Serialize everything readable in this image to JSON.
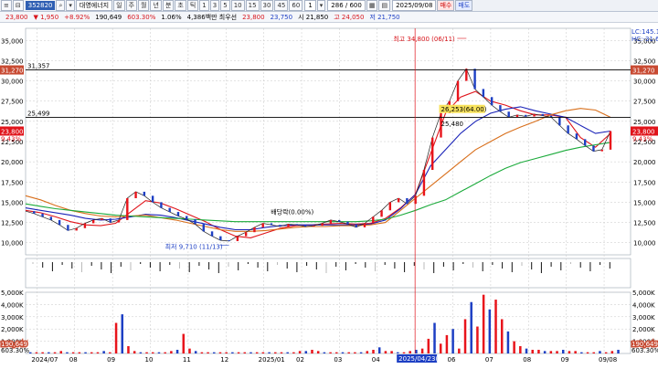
{
  "toolbar": {
    "code": "352820",
    "name": "대영에너지",
    "period_buttons": [
      "일",
      "주",
      "월",
      "년",
      "분",
      "초",
      "틱"
    ],
    "minute_buttons": [
      "1",
      "3",
      "5",
      "10",
      "15",
      "30",
      "45",
      "60"
    ],
    "tick_value": "1",
    "count_value": "286 / 600",
    "date_value": "2025/09/08"
  },
  "quote": {
    "price": "23,800",
    "change": "▼ 1,950",
    "change_pct": "+8.92%",
    "volume": "190,649",
    "volume_ratio": "603.30%",
    "turnover": "1.06%",
    "trade_value": "4,386백만 최우선",
    "ask": "23,800",
    "bid": "23,750",
    "open": "시 21,850",
    "high": "고 24,050",
    "low": "저 21,750",
    "buy_label": "매수",
    "sell_label": "매도"
  },
  "chart_data": {
    "type": "line",
    "x_labels": [
      "2024/07",
      "08",
      "09",
      "10",
      "11",
      "12",
      "2025/01",
      "02",
      "03",
      "04",
      "2025/04/23(수)",
      "06",
      "07",
      "08",
      "09",
      "09/08"
    ],
    "ylim": [
      8500,
      36500
    ],
    "y_ticks": [
      10000,
      12500,
      15000,
      17500,
      20000,
      22500,
      25000,
      27500,
      30000,
      32500,
      35000
    ],
    "y_tick_labels": [
      "10,000",
      "12,500",
      "15,000",
      "17,500",
      "20,000",
      "22,500",
      "25,000",
      "27,500",
      "30,000",
      "32,500",
      "35,000"
    ],
    "price_path": [
      13.9,
      13.6,
      13.2,
      12.8,
      12.2,
      11.5,
      11.8,
      12.4,
      12.8,
      13.0,
      12.5,
      12.8,
      15.5,
      16.3,
      15.8,
      15.0,
      14.3,
      13.8,
      13.3,
      12.9,
      12.3,
      11.4,
      10.8,
      10.3,
      10.2,
      10.8,
      11.3,
      11.9,
      12.4,
      12.2,
      12.0,
      12.3,
      12.2,
      12.0,
      12.1,
      12.4,
      12.8,
      12.6,
      12.3,
      11.9,
      12.4,
      13.2,
      14.0,
      15.0,
      15.5,
      14.8,
      15.8,
      19.0,
      23.0,
      26.0,
      27.5,
      30.0,
      31.5,
      29.0,
      28.0,
      27.0,
      26.2,
      25.5,
      25.8,
      25.6,
      25.9,
      25.7,
      25.5,
      24.5,
      23.5,
      22.8,
      22.0,
      21.3,
      21.5,
      23.8
    ],
    "ma20": [
      14.0,
      13.7,
      13.2,
      12.6,
      12.2,
      12.1,
      12.4,
      13.8,
      15.2,
      14.9,
      14.2,
      13.4,
      12.6,
      11.6,
      10.8,
      10.6,
      11.2,
      11.8,
      12.1,
      12.2,
      12.3,
      12.4,
      12.3,
      12.4,
      13.0,
      14.3,
      16.0,
      21.0,
      26.0,
      28.0,
      28.7,
      27.5,
      27.0,
      26.3,
      25.8,
      25.8,
      25.5,
      23.0,
      21.8,
      23.5
    ],
    "ma60": [
      14.3,
      14.0,
      13.7,
      13.4,
      13.0,
      12.8,
      12.9,
      13.2,
      13.5,
      13.4,
      13.1,
      12.7,
      12.3,
      11.9,
      11.6,
      11.6,
      11.9,
      12.1,
      12.2,
      12.2,
      12.2,
      12.2,
      12.2,
      12.3,
      12.8,
      14.2,
      16.0,
      19.5,
      21.5,
      23.5,
      25.0,
      26.0,
      26.5,
      26.8,
      26.3,
      25.9,
      25.5,
      24.5,
      23.5,
      23.8
    ],
    "ma120": [
      15.8,
      15.3,
      14.6,
      14.0,
      13.6,
      13.3,
      13.2,
      13.3,
      13.4,
      13.1,
      12.8,
      12.4,
      12.0,
      11.6,
      11.4,
      11.4,
      11.5,
      11.7,
      11.9,
      12.0,
      12.0,
      12.1,
      12.1,
      12.2,
      12.5,
      14.0,
      15.5,
      17.0,
      18.5,
      20.0,
      21.5,
      22.5,
      23.5,
      24.3,
      25.0,
      25.8,
      26.3,
      26.6,
      26.4,
      25.5
    ],
    "ma240": [
      14.8,
      14.5,
      14.2,
      14.0,
      13.8,
      13.6,
      13.4,
      13.3,
      13.2,
      13.1,
      13.0,
      12.9,
      12.8,
      12.7,
      12.6,
      12.6,
      12.6,
      12.6,
      12.6,
      12.6,
      12.6,
      12.6,
      12.6,
      12.7,
      12.9,
      13.4,
      14.0,
      14.7,
      15.3,
      16.3,
      17.3,
      18.3,
      19.2,
      19.9,
      20.4,
      20.9,
      21.4,
      21.8,
      22.1,
      22.4
    ],
    "hlines": [
      {
        "label": "31,357",
        "value": 31357,
        "badge": "31,270"
      },
      {
        "label": "25,499",
        "value": 25499
      }
    ],
    "annotations": {
      "high": "최고 34,800 (06/11)",
      "low": "최저 9,710 (11/13)",
      "dividend": "배당락(0.00%)",
      "price_26253": "26,253(64.00)",
      "price_25480": "25,480"
    },
    "right_badges": {
      "lc": "LC:145.14",
      "hc": "HC:-31.64",
      "current": "23,800",
      "current_pct": "9.43%"
    },
    "left_markers": {
      "current": "23,800",
      "current_pct": "9.43%"
    },
    "volume": {
      "ylim": [
        0,
        5000
      ],
      "y_tick_labels": [
        "1,000K",
        "2,000K",
        "3,000K",
        "4,000K",
        "5,000K"
      ],
      "current_value": "190,649",
      "current_pct": "603.30%",
      "bars": [
        0.1,
        0.1,
        0.1,
        0.1,
        0.1,
        0.2,
        0.1,
        0.1,
        0.1,
        0.1,
        0.1,
        0.1,
        0.2,
        0.1,
        2.5,
        3.2,
        0.6,
        0.2,
        0.1,
        0.1,
        0.1,
        0.1,
        0.1,
        0.2,
        0.3,
        1.6,
        0.4,
        0.2,
        0.1,
        0.1,
        0.1,
        0.1,
        0.1,
        0.1,
        0.1,
        0.1,
        0.1,
        0.1,
        0.1,
        0.1,
        0.1,
        0.1,
        0.1,
        0.1,
        0.2,
        0.2,
        0.3,
        0.2,
        0.1,
        0.1,
        0.1,
        0.1,
        0.1,
        0.1,
        0.1,
        0.2,
        0.3,
        0.5,
        0.2,
        0.2,
        0.1,
        0.1,
        0.2,
        0.3,
        0.4,
        1.2,
        2.5,
        0.8,
        1.5,
        2.0,
        0.4,
        2.8,
        4.2,
        2.2,
        4.8,
        3.6,
        4.4,
        2.8,
        1.8,
        1.0,
        0.6,
        0.4,
        0.3,
        0.3,
        0.2,
        0.2,
        0.2,
        0.3,
        0.2,
        0.2,
        0.1,
        0.1,
        0.1,
        0.2,
        0.1,
        0.2,
        0.3
      ]
    }
  },
  "colors": {
    "up": "#e8141b",
    "down": "#1d3fc4",
    "ma20": "#e0141b",
    "ma60": "#1a23b8",
    "ma120": "#d86e1a",
    "ma240": "#1aaa3a",
    "panel_bg": "#ffffff",
    "grid": "#c7c7c7"
  }
}
